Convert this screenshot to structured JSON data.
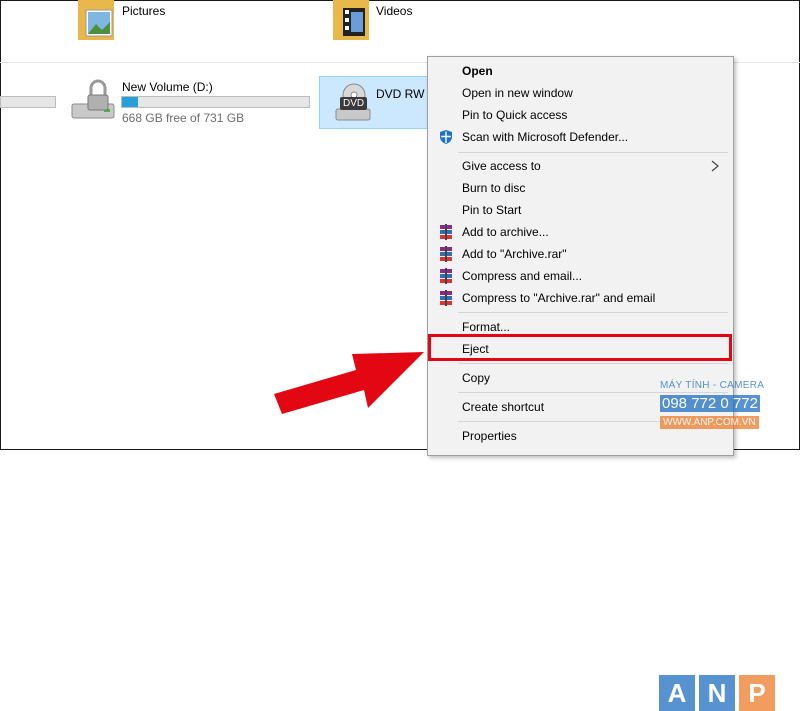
{
  "folders": [
    {
      "label": "Pictures",
      "icon": "pictures-folder-icon"
    },
    {
      "label": "Videos",
      "icon": "videos-folder-icon"
    }
  ],
  "drives": [
    {
      "name": "New Volume (D:)",
      "free_text": "668 GB free of 731 GB",
      "usage_fraction": 0.086,
      "icon": "locked-drive-icon"
    },
    {
      "name": "DVD RW D",
      "icon": "dvd-drive-icon",
      "badge": "DVD"
    }
  ],
  "context_menu": {
    "items": [
      {
        "label": "Open",
        "bold": true
      },
      {
        "label": "Open in new window"
      },
      {
        "label": "Pin to Quick access"
      },
      {
        "label": "Scan with Microsoft Defender...",
        "icon": "defender-shield-icon"
      },
      {
        "label": "Give access to",
        "submenu": true
      },
      {
        "label": "Burn to disc"
      },
      {
        "label": "Pin to Start"
      },
      {
        "label": "Add to archive...",
        "icon": "winrar-icon"
      },
      {
        "label": "Add to \"Archive.rar\"",
        "icon": "winrar-icon"
      },
      {
        "label": "Compress and email...",
        "icon": "winrar-icon"
      },
      {
        "label": "Compress to \"Archive.rar\" and email",
        "icon": "winrar-icon"
      },
      {
        "label": "Format..."
      },
      {
        "label": "Eject",
        "highlighted": true
      },
      {
        "label": "Copy"
      },
      {
        "label": "Create shortcut"
      },
      {
        "label": "Properties"
      }
    ]
  },
  "watermark": {
    "letters": [
      "A",
      "N",
      "P"
    ],
    "line1": "MÁY TÍNH - CAMERA",
    "line2": "098 772 0 772",
    "line3": "WWW.ANP.COM.VN"
  },
  "colors": {
    "accent_red": "#e30613",
    "selection_blue": "#cce8ff",
    "progress_blue": "#26a0da",
    "watermark_blue": "#1f6fc1",
    "watermark_orange": "#f07c2b"
  }
}
